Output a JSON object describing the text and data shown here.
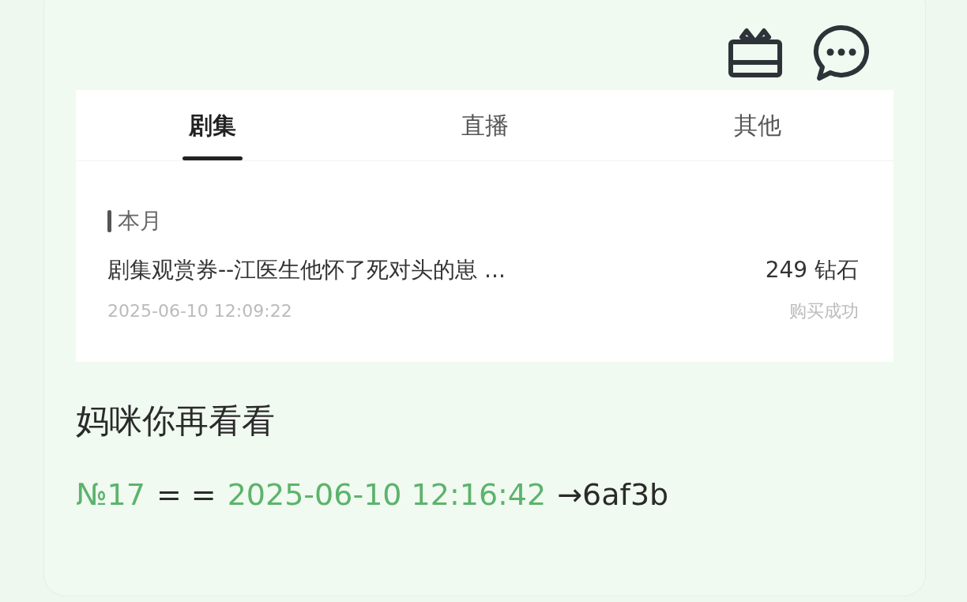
{
  "screenshot": {
    "tabs": [
      {
        "label": "剧集",
        "selected": true
      },
      {
        "label": "直播",
        "selected": false
      },
      {
        "label": "其他",
        "selected": false
      }
    ],
    "section": "本月",
    "records": [
      {
        "title": "剧集观赏券--江医生他怀了死对头的崽 ...",
        "amount": "249 钻石",
        "time": "2025-06-10 12:09:22",
        "status": "购买成功"
      }
    ]
  },
  "message": "妈咪你再看看",
  "footer": {
    "number": "№17",
    "separator": "= =",
    "timestamp": "2025-06-10 12:16:42",
    "hash": "→6af3b"
  }
}
